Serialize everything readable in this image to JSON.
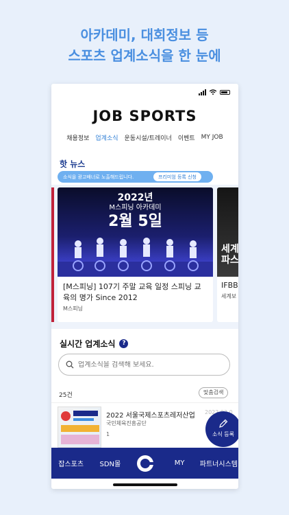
{
  "promo": {
    "line1": "아카데미, 대회정보 등",
    "line2": "스포츠 업계소식을 한 눈에"
  },
  "app": {
    "logo": "JOB SPORTS",
    "nav": [
      "채용정보",
      "업계소식",
      "운동시설/트레이너",
      "이벤트",
      "MY JOB"
    ],
    "active_nav": "업계소식"
  },
  "hot_news": {
    "title": "핫 뉴스",
    "ad_text": "소식을 광고배너로 노출해드립니다.",
    "ad_button": "프리미엄 등록 신청",
    "cards": [
      {
        "image_year": "2022년",
        "image_sub": "M스피닝 아카데미",
        "image_date": "2월 5일",
        "title": "[M스피닝] 107기 주말 교육 일정 스피닝 교육의 명가 Since 2012",
        "tag": "M스피닝"
      },
      {
        "image_text": "세계 파스",
        "title": "IFBB",
        "tag": "세계보"
      }
    ]
  },
  "realtime": {
    "title": "실시간 업계소식",
    "help_icon": "question-icon",
    "search_placeholder": "업계소식을 검색해 보세요.",
    "count": "25건",
    "filter_button": "맞춤검색",
    "items": [
      {
        "title": "2022 서울국제스포츠레저산업전",
        "org": "국민체육진흥공단",
        "views": "1",
        "date": "2022.02.0"
      }
    ]
  },
  "fab": {
    "label": "소식 등록",
    "icon": "pencil-icon"
  },
  "bottom_nav": {
    "items": [
      "잡스포츠",
      "SDN몰",
      "MY",
      "파트너시스템"
    ],
    "center_icon": "c-logo-icon"
  },
  "colors": {
    "promo": "#4a8fe0",
    "brand_navy": "#1a2a8a",
    "accent_blue": "#2f7fd6",
    "banner": "#6fb0f0"
  }
}
